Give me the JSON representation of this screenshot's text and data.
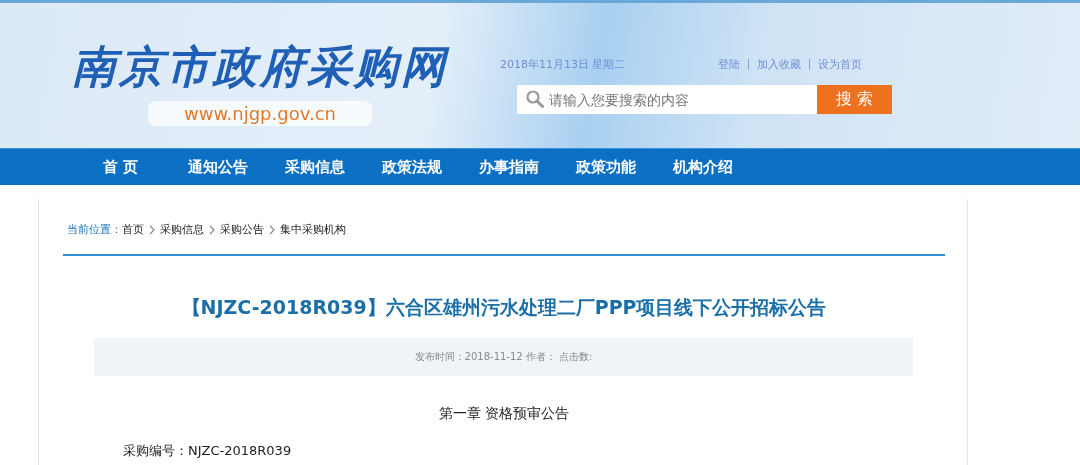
{
  "header": {
    "logo": "南京市政府采购网",
    "url": "www.njgp.gov.cn",
    "date": "2018年11月13日 星期二",
    "links": [
      "登陆",
      "加入收藏",
      "设为首页"
    ],
    "search": {
      "placeholder": "请输入您要搜索的内容",
      "button": "搜 索"
    }
  },
  "nav": [
    {
      "label": "首 页"
    },
    {
      "label": "通知公告"
    },
    {
      "label": "采购信息"
    },
    {
      "label": "政策法规"
    },
    {
      "label": "办事指南"
    },
    {
      "label": "政策功能"
    },
    {
      "label": "机构介绍"
    }
  ],
  "breadcrumb": {
    "label": "当前位置：",
    "items": [
      "首页",
      "采购信息",
      "采购公告",
      "集中采购机构"
    ]
  },
  "article": {
    "title": "【NJZC-2018R039】六合区雄州污水处理二厂PPP项目线下公开招标公告",
    "meta": "发布时间：2018-11-12 作者： 点击数:",
    "chapter": "第一章 资格预审公告",
    "lines": [
      "采购编号：NJZC-2018R039"
    ]
  }
}
